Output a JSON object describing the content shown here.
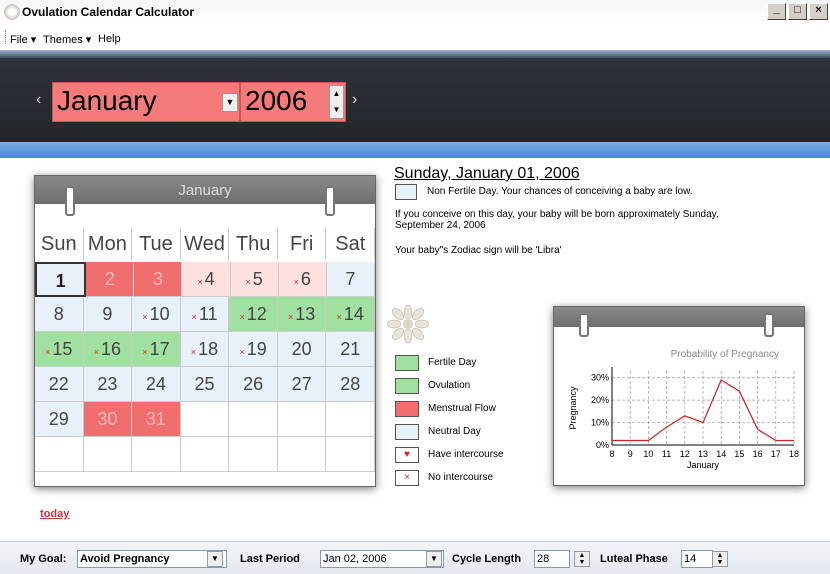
{
  "window": {
    "title": "Ovulation Calendar Calculator",
    "controls": [
      "_",
      "□",
      "×"
    ]
  },
  "menu": [
    "File ▾",
    "Themes ▾",
    "Help"
  ],
  "header": {
    "month": "January",
    "year": "2006",
    "prev": "‹",
    "next": "›"
  },
  "calendar": {
    "month": "January",
    "daynames": [
      "Sun",
      "Mon",
      "Tue",
      "Wed",
      "Thu",
      "Fri",
      "Sat"
    ],
    "weeks": [
      [
        {
          "d": "1",
          "t": "selected",
          "m": ""
        },
        {
          "d": "2",
          "t": "menstrual",
          "m": ""
        },
        {
          "d": "3",
          "t": "menstrual",
          "m": ""
        },
        {
          "d": "4",
          "t": "pink",
          "m": "×"
        },
        {
          "d": "5",
          "t": "pink",
          "m": "×"
        },
        {
          "d": "6",
          "t": "pink",
          "m": "×"
        },
        {
          "d": "7",
          "t": "neutral",
          "m": ""
        }
      ],
      [
        {
          "d": "8",
          "t": "neutral",
          "m": ""
        },
        {
          "d": "9",
          "t": "neutral",
          "m": ""
        },
        {
          "d": "10",
          "t": "neutral",
          "m": "×"
        },
        {
          "d": "11",
          "t": "neutral",
          "m": "×"
        },
        {
          "d": "12",
          "t": "fertile",
          "m": "×"
        },
        {
          "d": "13",
          "t": "fertile",
          "m": "×"
        },
        {
          "d": "14",
          "t": "fertile",
          "m": "×"
        }
      ],
      [
        {
          "d": "15",
          "t": "fertile",
          "m": "×"
        },
        {
          "d": "16",
          "t": "fertile",
          "m": "×"
        },
        {
          "d": "17",
          "t": "fertile",
          "m": "×"
        },
        {
          "d": "18",
          "t": "neutral",
          "m": "×"
        },
        {
          "d": "19",
          "t": "neutral",
          "m": "×"
        },
        {
          "d": "20",
          "t": "neutral",
          "m": ""
        },
        {
          "d": "21",
          "t": "neutral",
          "m": ""
        }
      ],
      [
        {
          "d": "22",
          "t": "neutral",
          "m": ""
        },
        {
          "d": "23",
          "t": "neutral",
          "m": ""
        },
        {
          "d": "24",
          "t": "neutral",
          "m": ""
        },
        {
          "d": "25",
          "t": "neutral",
          "m": ""
        },
        {
          "d": "26",
          "t": "neutral",
          "m": ""
        },
        {
          "d": "27",
          "t": "neutral",
          "m": ""
        },
        {
          "d": "28",
          "t": "neutral",
          "m": ""
        }
      ],
      [
        {
          "d": "29",
          "t": "neutral",
          "m": ""
        },
        {
          "d": "30",
          "t": "menstrual",
          "m": ""
        },
        {
          "d": "31",
          "t": "menstrual",
          "m": ""
        },
        {
          "d": "",
          "t": "empty",
          "m": ""
        },
        {
          "d": "",
          "t": "empty",
          "m": ""
        },
        {
          "d": "",
          "t": "empty",
          "m": ""
        },
        {
          "d": "",
          "t": "empty",
          "m": ""
        }
      ],
      [
        {
          "d": "",
          "t": "empty",
          "m": ""
        },
        {
          "d": "",
          "t": "empty",
          "m": ""
        },
        {
          "d": "",
          "t": "empty",
          "m": ""
        },
        {
          "d": "",
          "t": "empty",
          "m": ""
        },
        {
          "d": "",
          "t": "empty",
          "m": ""
        },
        {
          "d": "",
          "t": "empty",
          "m": ""
        },
        {
          "d": "",
          "t": "empty",
          "m": ""
        }
      ]
    ],
    "today_link": "today"
  },
  "info": {
    "date": "Sunday, January 01, 2006",
    "line1": "Non Fertile Day. Your chances of conceiving a baby are low.",
    "line2": "If you conceive on this day, your baby will be born approximately Sunday,",
    "line3": "September 24, 2006",
    "line4": "Your baby\"s Zodiac sign will be 'Libra'"
  },
  "legend": [
    {
      "label": "Fertile Day",
      "color": "#a0e0a0",
      "mark": ""
    },
    {
      "label": "Ovulation",
      "color": "#a0e0a0",
      "mark": ""
    },
    {
      "label": "Menstrual Flow",
      "color": "#f06e6e",
      "mark": ""
    },
    {
      "label": "Neutral Day",
      "color": "#e8f1fa",
      "mark": ""
    },
    {
      "label": "Have intercourse",
      "color": "#ffffff",
      "mark": "♥"
    },
    {
      "label": "No intercourse",
      "color": "#ffffff",
      "mark": "×"
    }
  ],
  "chart_data": {
    "type": "line",
    "title": "Probability of Pregnancy",
    "xlabel": "January",
    "ylabel": "Pregnancy",
    "x": [
      8,
      9,
      10,
      11,
      12,
      13,
      14,
      15,
      16,
      17,
      18
    ],
    "values": [
      2,
      2,
      2,
      8,
      13,
      10,
      29,
      24,
      7,
      2,
      2
    ],
    "yticks": [
      "0%",
      "10%",
      "20%",
      "30%"
    ],
    "ylim": [
      0,
      33
    ],
    "grid": true,
    "color": "#cc2222"
  },
  "bottom": {
    "goal_label": "My Goal:",
    "goal_value": "Avoid Pregnancy",
    "period_label": "Last Period",
    "period_value": "Jan 02, 2006",
    "cycle_label": "Cycle Length",
    "cycle_value": "28",
    "luteal_label": "Luteal Phase",
    "luteal_value": "14"
  }
}
